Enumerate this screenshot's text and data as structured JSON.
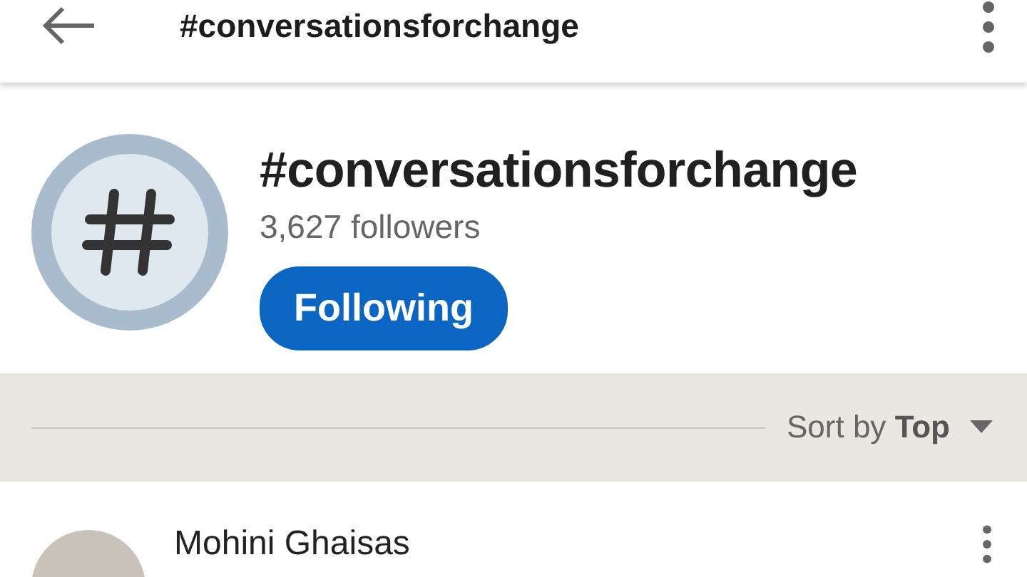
{
  "top_bar": {
    "title": "#conversationsforchange"
  },
  "hashtag": {
    "name": "#conversationsforchange",
    "followers": "3,627 followers",
    "follow_button": {
      "label": "Following",
      "selected": true
    }
  },
  "sort": {
    "label": "Sort by",
    "value": "Top"
  },
  "posts": [
    {
      "author": "Mohini Ghaisas"
    }
  ]
}
